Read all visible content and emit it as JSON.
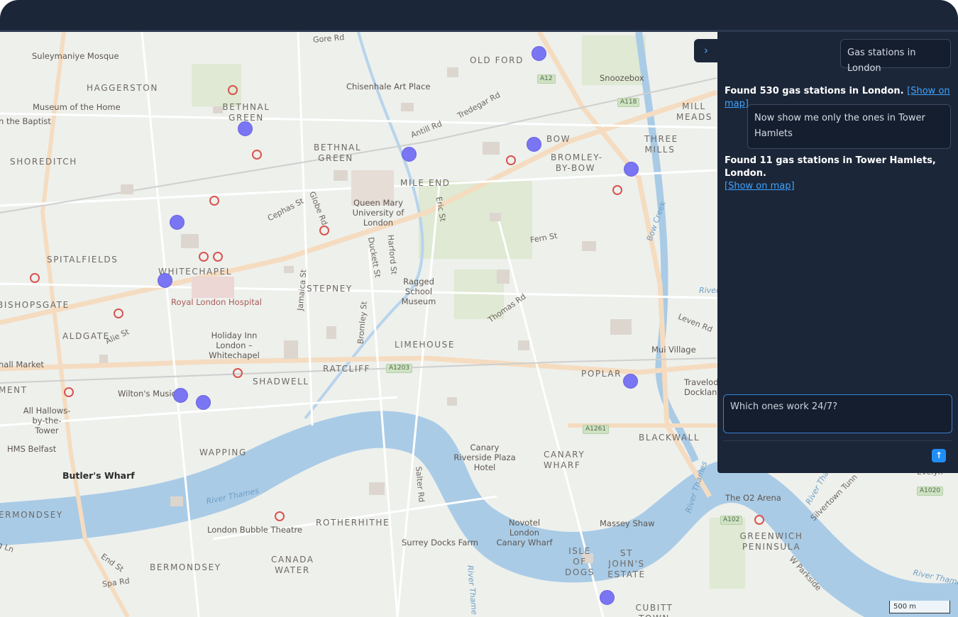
{
  "chat": {
    "messages": [
      {
        "role": "user",
        "text": "Gas stations in London"
      },
      {
        "role": "assistant",
        "text": "Found 530 gas stations in London.",
        "link": "[Show on map]"
      },
      {
        "role": "user",
        "text": "Now show me only the ones in Tower Hamlets"
      },
      {
        "role": "assistant",
        "text": "Found 11 gas stations in Tower Hamlets, London.",
        "link": "[Show on map]"
      }
    ],
    "input_value": "Which ones work 24/7?",
    "send_icon": "arrow-up-icon",
    "toggle_icon": "chevron-right-icon",
    "toggle_glyph": "›",
    "send_glyph": "↑"
  },
  "map": {
    "scale_label": "500 m",
    "marker_color": "#7a75f2",
    "areas": [
      "OLD FORD",
      "HAGGERSTON",
      "BETHNAL GREEN",
      "BETHNAL GREEN",
      "SHOREDITCH",
      "MILE END",
      "BOW",
      "BROMLEY-BY-BOW",
      "THREE MILLS",
      "MILL MEADS",
      "SPITALFIELDS",
      "WHITECHAPEL",
      "STEPNEY",
      "BISHOPSGATE",
      "ALDGATE",
      "LIMEHOUSE",
      "RATCLIFF",
      "SHADWELL",
      "POPLAR",
      "BLACKWALL",
      "CANARY WHARF",
      "WAPPING",
      "ROTHERHITHE",
      "BERMONDSEY",
      "CANADA WATER",
      "ISLE OF DOGS",
      "ST JOHN'S ESTATE",
      "CUBITT TOWN",
      "GREENWICH PENINSULA",
      "ERMONDSEY",
      "MENT"
    ],
    "pois": [
      "Suleymaniye Mosque",
      "Museum of the Home",
      "n the Baptist",
      "Chisenhale Art Place",
      "Snoozebox",
      "Queen Mary University of London",
      "Ragged School Museum",
      "Royal London Hospital",
      "Holiday Inn London – Whitechapel",
      "Mui Village",
      "Wilton's Music",
      "All Hallows-by-the-Tower",
      "HMS Belfast",
      "hall Market",
      "Canary Riverside Plaza Hotel",
      "Novotel London Canary Wharf",
      "Massey Shaw",
      "Surrey Docks Farm",
      "London Bubble Theatre",
      "The O2 Arena",
      "Travelod Docklan",
      "Butler's Wharf"
    ],
    "roads": [
      "Gore Rd",
      "Tredegar Rd",
      "Antill Rd",
      "Cephas St",
      "Globe Rd",
      "Eric St",
      "Harford St",
      "Duckett St",
      "Fern St",
      "Thomas Rd",
      "Jamaica St",
      "Bromley St",
      "Alie St",
      "Leven Rd",
      "Salter Rd",
      "End St",
      "Spa Rd",
      "W Parkside",
      "Silvertown Tunn",
      "g Ln",
      "Bow Creek",
      "Evelyn"
    ],
    "shields": [
      "A12",
      "A118",
      "A1203",
      "A1261",
      "A102",
      "A1020"
    ],
    "water": [
      "River Thames",
      "River Thames",
      "River Thame",
      "River",
      "River Thame",
      "River Thames"
    ]
  }
}
